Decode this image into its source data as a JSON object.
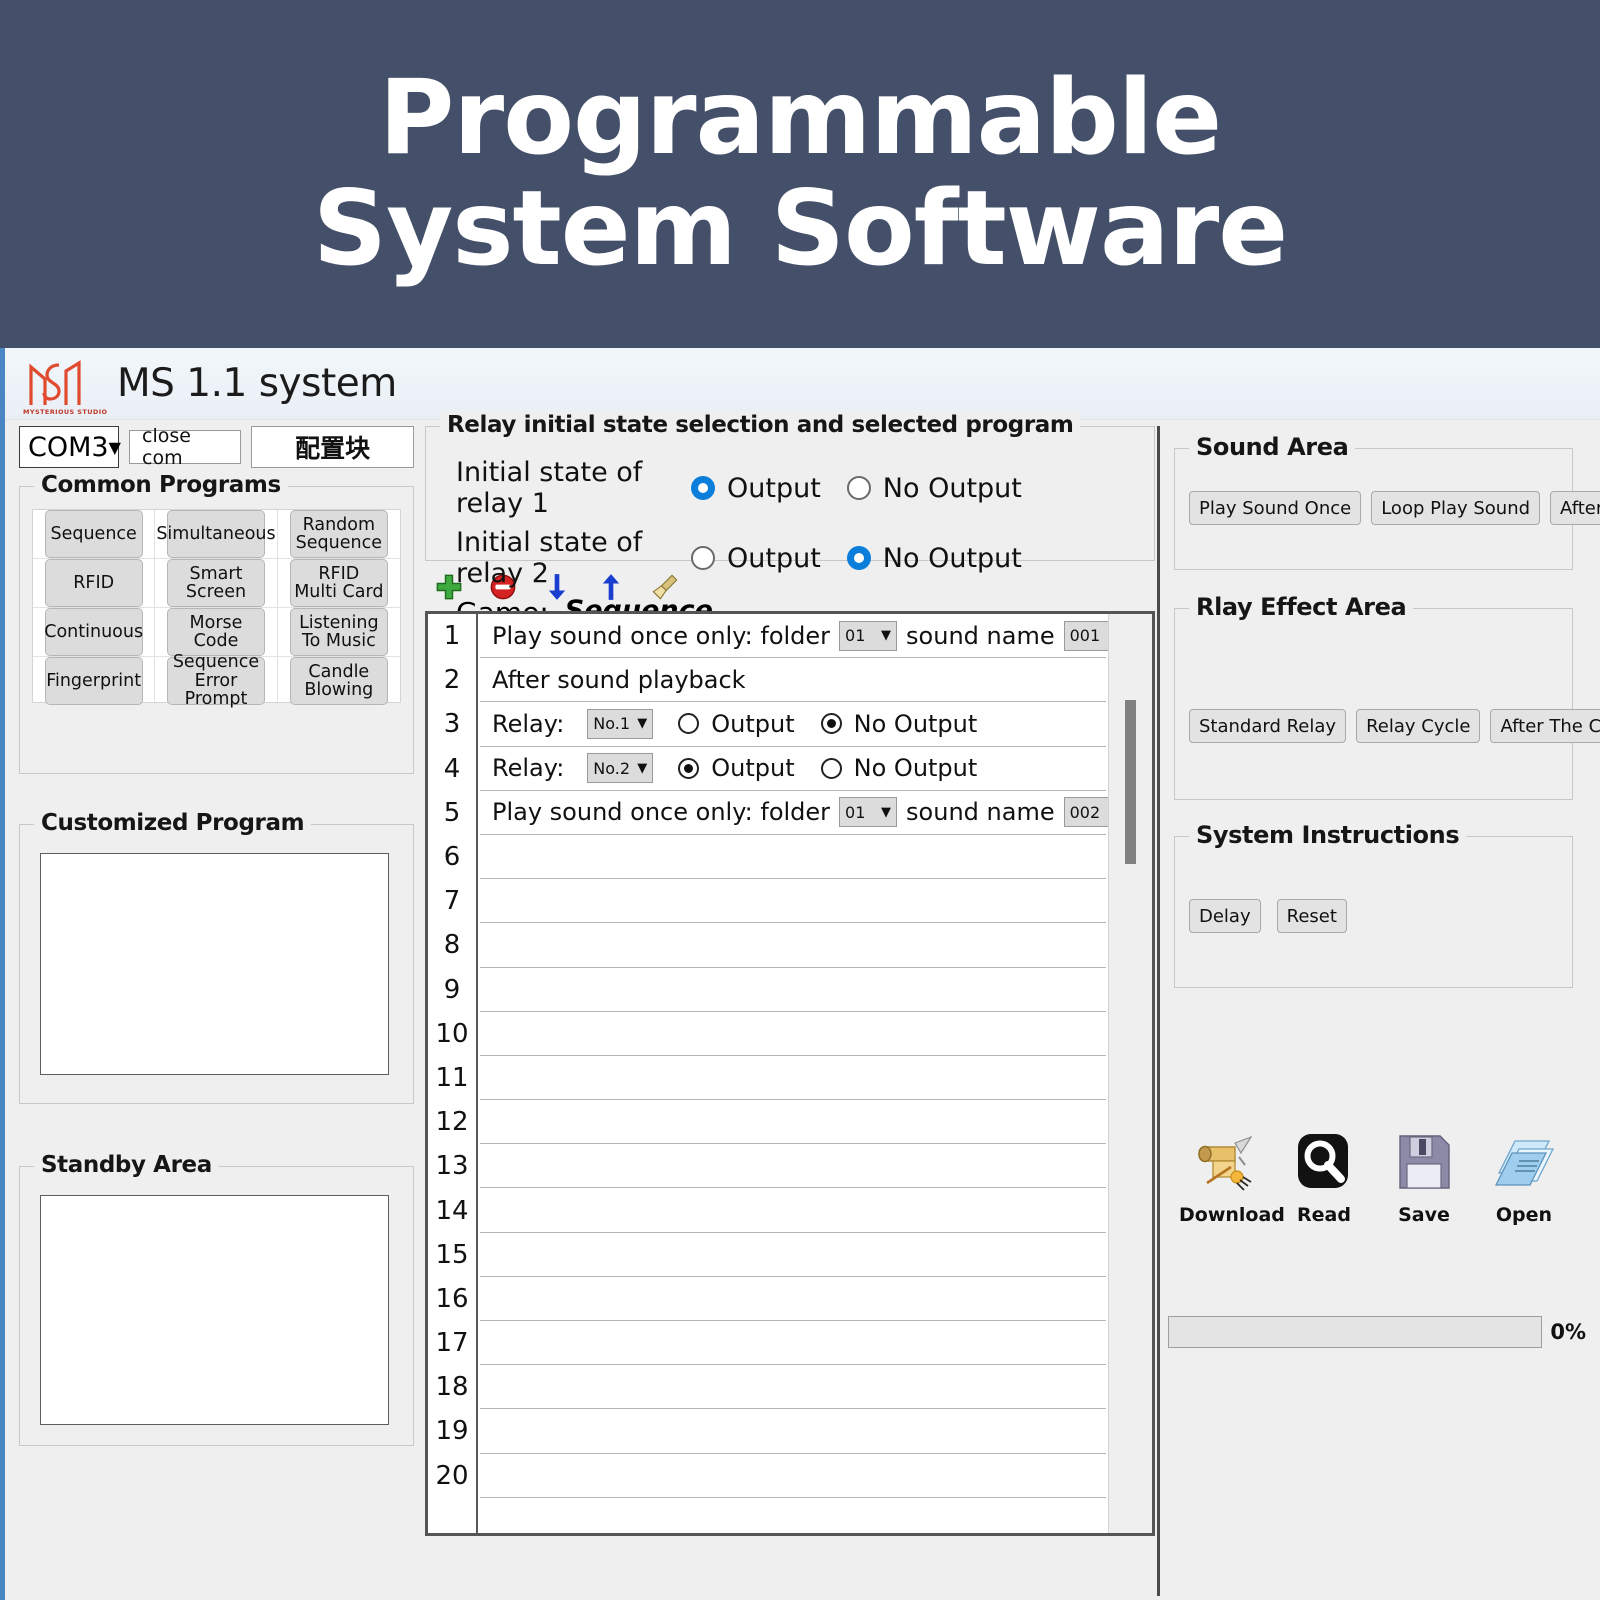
{
  "banner": {
    "line1": "Programmable",
    "line2": "System Software",
    "bg": "#445069"
  },
  "titlebar": {
    "app_title": "MS 1.1 system",
    "logo_text": "MYSTERIOUS STUDIO",
    "logo_color": "#e04a2f"
  },
  "toolbar": {
    "com_port": "COM3",
    "com_arrow": "▼",
    "close_com_label": "close com",
    "config_block_label": "配置块"
  },
  "common_programs": {
    "title": "Common Programs",
    "buttons": [
      "Sequence",
      "Simultaneous",
      "Random\nSequence",
      "RFID",
      "Smart\nScreen",
      "RFID\nMulti Card",
      "Continuous",
      "Morse Code",
      "Listening\nTo Music",
      "Fingerprint",
      "Sequence\nError Prompt",
      "Candle\nBlowing"
    ]
  },
  "customized_program": {
    "title": "Customized Program",
    "content": ""
  },
  "standby_area": {
    "title": "Standby Area",
    "content": ""
  },
  "relay_box": {
    "title": "Relay initial state selection and selected program",
    "relay1": {
      "label": "Initial state of relay 1",
      "output_label": "Output",
      "no_output_label": "No Output",
      "selected": "Output"
    },
    "relay2": {
      "label": "Initial state of relay 2",
      "output_label": "Output",
      "no_output_label": "No Output",
      "selected": "No Output"
    },
    "game_label": "Game:",
    "game_value": "Sequence"
  },
  "mid_toolbar": {
    "icons": [
      "add-icon",
      "remove-icon",
      "move-down-icon",
      "move-up-icon",
      "clear-broom-icon"
    ]
  },
  "program_list": {
    "row_numbers": [
      1,
      2,
      3,
      4,
      5,
      6,
      7,
      8,
      9,
      10,
      11,
      12,
      13,
      14,
      15,
      16,
      17,
      18,
      19,
      20
    ],
    "rows": [
      {
        "n": 1,
        "type": "play_sound_once",
        "text_before": "Play sound once only: folder",
        "folder": "01",
        "text_mid": "sound name",
        "sound": "001"
      },
      {
        "n": 2,
        "type": "text",
        "text": "After sound playback"
      },
      {
        "n": 3,
        "type": "relay",
        "label": "Relay:",
        "relay": "No.1",
        "output_label": "Output",
        "no_output_label": "No Output",
        "selected": "No Output"
      },
      {
        "n": 4,
        "type": "relay",
        "label": "Relay:",
        "relay": "No.2",
        "output_label": "Output",
        "no_output_label": "No Output",
        "selected": "Output"
      },
      {
        "n": 5,
        "type": "play_sound_once",
        "text_before": "Play sound once only: folder",
        "folder": "01",
        "text_mid": "sound name",
        "sound": "002"
      },
      {
        "n": 6,
        "type": "empty",
        "text": ""
      },
      {
        "n": 7,
        "type": "empty",
        "text": ""
      },
      {
        "n": 8,
        "type": "empty",
        "text": ""
      },
      {
        "n": 9,
        "type": "empty",
        "text": ""
      },
      {
        "n": 10,
        "type": "empty",
        "text": ""
      },
      {
        "n": 11,
        "type": "empty",
        "text": ""
      },
      {
        "n": 12,
        "type": "empty",
        "text": ""
      },
      {
        "n": 13,
        "type": "empty",
        "text": ""
      },
      {
        "n": 14,
        "type": "empty",
        "text": ""
      },
      {
        "n": 15,
        "type": "empty",
        "text": ""
      },
      {
        "n": 16,
        "type": "empty",
        "text": ""
      },
      {
        "n": 17,
        "type": "empty",
        "text": ""
      },
      {
        "n": 18,
        "type": "empty",
        "text": ""
      },
      {
        "n": 19,
        "type": "empty",
        "text": ""
      },
      {
        "n": 20,
        "type": "empty",
        "text": ""
      }
    ]
  },
  "sound_area": {
    "title": "Sound Area",
    "buttons": [
      "Play Sound Once",
      "Loop Play Sound",
      "After Sound Play"
    ]
  },
  "relay_effect_area": {
    "title": "Rlay Effect Area",
    "buttons": [
      "Standard Relay",
      "Relay Cycle",
      "After The Cycle Relay"
    ]
  },
  "system_instructions": {
    "title": "System Instructions",
    "buttons": [
      "Delay",
      "Reset"
    ]
  },
  "action_icons": [
    {
      "name": "download-icon",
      "caption": "Download"
    },
    {
      "name": "read-magnifier-icon",
      "caption": "Read"
    },
    {
      "name": "save-floppy-icon",
      "caption": "Save"
    },
    {
      "name": "open-folder-icon",
      "caption": "Open"
    }
  ],
  "progress": {
    "percent_label": "0%",
    "value": 0
  }
}
